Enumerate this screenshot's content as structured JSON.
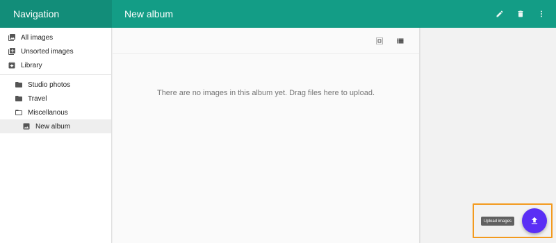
{
  "nav": {
    "title": "Navigation"
  },
  "appbar": {
    "title": "New album",
    "actions": [
      {
        "icon": "pencil-icon"
      },
      {
        "icon": "trash-icon"
      },
      {
        "icon": "more-vert-icon"
      }
    ]
  },
  "sidebar": {
    "items": [
      {
        "label": "All images",
        "icon": "images-icon"
      },
      {
        "label": "Unsorted images",
        "icon": "unsorted-icon"
      },
      {
        "label": "Library",
        "icon": "archive-icon"
      },
      {
        "label": "Studio photos",
        "icon": "folder-icon"
      },
      {
        "label": "Travel",
        "icon": "folder-icon"
      },
      {
        "label": "Miscellanous",
        "icon": "folder-outline-icon"
      },
      {
        "label": "New album",
        "icon": "photo-album-icon"
      }
    ]
  },
  "main": {
    "toolbar": [
      {
        "icon": "grid-view-icon"
      },
      {
        "icon": "list-view-icon"
      }
    ],
    "empty_message": "There are no images in this album yet. Drag files here to upload."
  },
  "fab": {
    "tooltip": "Upload images",
    "icon": "upload-icon"
  },
  "colors": {
    "nav_header": "#128d79",
    "appbar": "#139d86",
    "fab": "#5a2ef5",
    "highlight": "#f39a1e"
  }
}
